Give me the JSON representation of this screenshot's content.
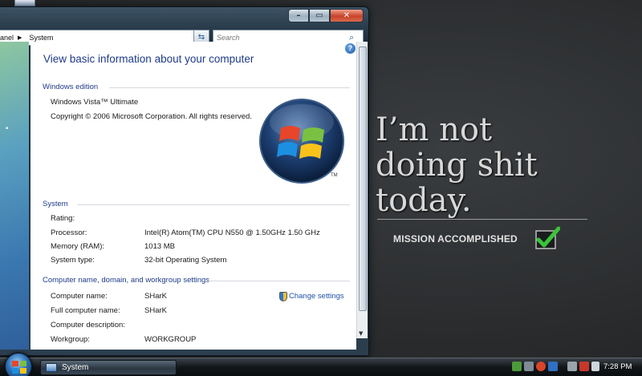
{
  "window": {
    "breadcrumb": [
      "anel",
      "System"
    ],
    "search_placeholder": "Search",
    "controls": {
      "minimize": "–",
      "maximize": "▭",
      "close": "✕"
    }
  },
  "content": {
    "help": "?",
    "title": "View basic information about your computer",
    "edition": {
      "label": "Windows edition",
      "name": "Windows Vista™ Ultimate",
      "copyright": "Copyright © 2006 Microsoft Corporation.  All rights reserved.",
      "tm": "TM"
    },
    "system": {
      "label": "System",
      "rows": [
        {
          "key": "Rating:",
          "value": ""
        },
        {
          "key": "Processor:",
          "value": "Intel(R) Atom(TM) CPU N550   @ 1.50GHz   1.50 GHz"
        },
        {
          "key": "Memory (RAM):",
          "value": "1013 MB"
        },
        {
          "key": "System type:",
          "value": "32-bit Operating System"
        }
      ]
    },
    "computer": {
      "label": "Computer name, domain, and workgroup settings",
      "change_settings": "Change settings",
      "rows": [
        {
          "key": "Computer name:",
          "value": "SHarK"
        },
        {
          "key": "Full computer name:",
          "value": "SHarK"
        },
        {
          "key": "Computer description:",
          "value": ""
        },
        {
          "key": "Workgroup:",
          "value": "WORKGROUP"
        }
      ]
    }
  },
  "wallpaper": {
    "quote": "I’m not\ndoing shit\ntoday.",
    "mission": "MISSION ACCOMPLISHED"
  },
  "taskbar": {
    "task_label": "System",
    "clock": "7:28 PM"
  },
  "colors": {
    "link": "#1f52a8",
    "heading": "#1e3b8a",
    "check": "#39c43a"
  }
}
